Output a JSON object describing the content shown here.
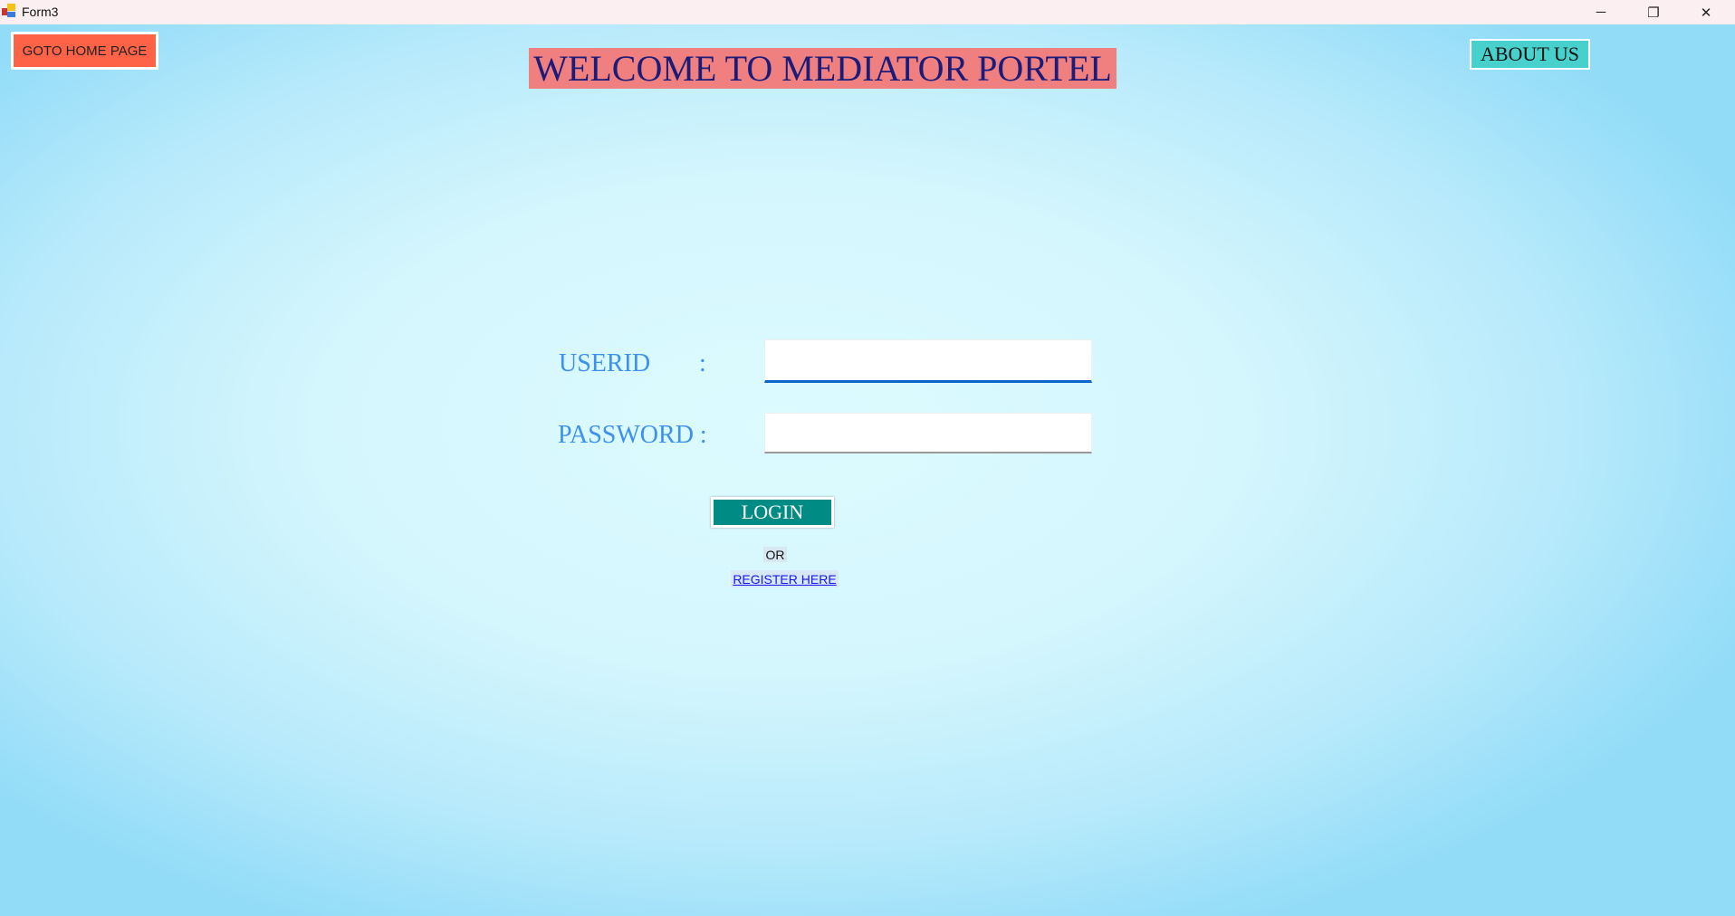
{
  "window": {
    "title": "Form3",
    "minimize": "─",
    "restore": "❐",
    "close": "✕"
  },
  "header": {
    "home_button": "GOTO HOME PAGE",
    "welcome": "WELCOME TO MEDIATOR PORTEL",
    "about_button": "ABOUT US"
  },
  "form": {
    "userid_label": "USERID",
    "userid_colon": ":",
    "userid_value": "",
    "password_label": "PASSWORD :",
    "password_value": "",
    "login_button": "LOGIN",
    "or_text": "OR",
    "register_link": "REGISTER HERE"
  },
  "colors": {
    "home": "#ff6347",
    "welcome_bg": "#f08080",
    "about": "#48d1cc",
    "login": "#008b84"
  }
}
